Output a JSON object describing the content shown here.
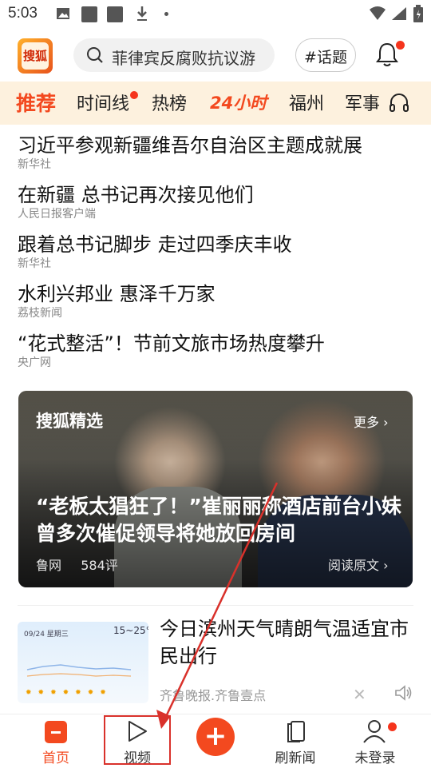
{
  "status_bar": {
    "time": "5:03"
  },
  "header": {
    "logo_text": "搜狐",
    "search_placeholder": "菲律宾反腐败抗议游",
    "topic_button": "#话题"
  },
  "channels": {
    "tabs": [
      {
        "label": "推荐"
      },
      {
        "label": "时间线"
      },
      {
        "label": "热榜"
      },
      {
        "label": "24小时"
      },
      {
        "label": "福州"
      },
      {
        "label": "军事"
      }
    ]
  },
  "news": [
    {
      "title": "习近平参观新疆维吾尔自治区主题成就展",
      "source": "新华社"
    },
    {
      "title": "在新疆 总书记再次接见他们",
      "source": "人民日报客户端"
    },
    {
      "title": "跟着总书记脚步 走过四季庆丰收",
      "source": "新华社"
    },
    {
      "title": "水利兴邦业 惠泽千万家",
      "source": "荔枝新闻"
    },
    {
      "title": "“花式整活”！节前文旅市场热度攀升",
      "source": "央广网"
    }
  ],
  "featured": {
    "brand": "搜狐精选",
    "more": "更多 ›",
    "title": "“老板太猖狂了！”崔丽丽称酒店前台小妹曾多次催促领导将她放回房间",
    "source": "鲁网",
    "comments": "584评",
    "read_original": "阅读原文 ›"
  },
  "weather_item": {
    "title": "今日滨州天气晴朗气温适宜市民出行",
    "sources": "齐鲁晚报.齐鲁壹点",
    "thumb_date": "09/24 星期三",
    "thumb_temp": "15~25℃"
  },
  "bottom_nav": {
    "home": "首页",
    "video": "视频",
    "refresh": "刷新闻",
    "profile": "未登录"
  },
  "colors": {
    "accent": "#f3491f",
    "tab_bar_bg": "#fdf1de",
    "annotation": "#d9312b"
  }
}
